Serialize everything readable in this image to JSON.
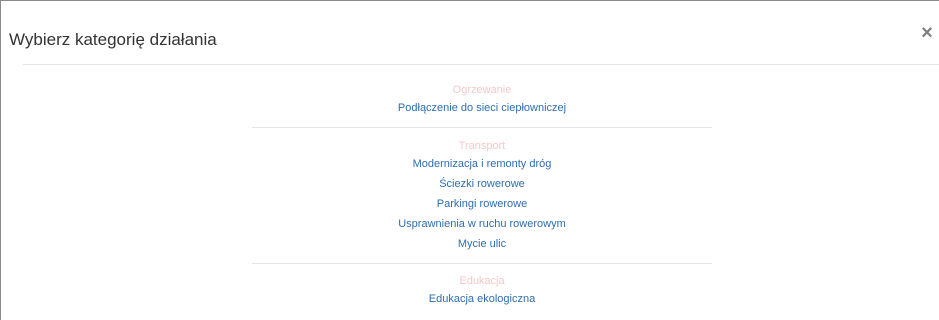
{
  "modal": {
    "title": "Wybierz kategorię działania",
    "close_label": "×"
  },
  "sections": [
    {
      "heading": "Ogrzewanie",
      "items": [
        "Podłączenie do sieci ciepłowniczej"
      ]
    },
    {
      "heading": "Transport",
      "items": [
        "Modernizacja i remonty dróg",
        "Ściezki rowerowe",
        "Parkingi rowerowe",
        "Usprawnienia w ruchu rowerowym",
        "Mycie ulic"
      ]
    },
    {
      "heading": "Edukacja",
      "items": [
        "Edukacja ekologiczna"
      ]
    }
  ],
  "colors": {
    "heading": "#f4c9c9",
    "link": "#2f6db0",
    "title": "#333333",
    "divider": "#e5e5e5"
  }
}
